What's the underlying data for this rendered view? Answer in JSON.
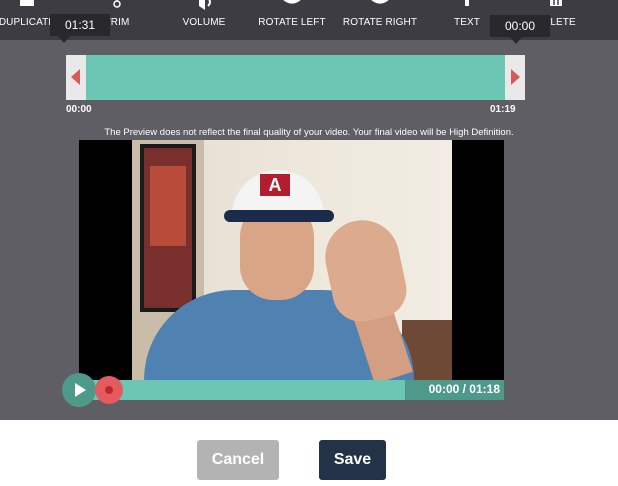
{
  "toolbar": {
    "items": [
      {
        "label": "DUPLICATE",
        "icon": "duplicate-icon"
      },
      {
        "label": "TRIM",
        "icon": "trim-icon"
      },
      {
        "label": "VOLUME",
        "icon": "volume-icon"
      },
      {
        "label": "ROTATE LEFT",
        "icon": "rotate-left-icon"
      },
      {
        "label": "ROTATE RIGHT",
        "icon": "rotate-right-icon"
      },
      {
        "label": "TEXT",
        "icon": "text-icon"
      },
      {
        "label": "DELETE",
        "icon": "delete-icon"
      }
    ]
  },
  "trim": {
    "start_tooltip": "01:31",
    "end_tooltip": "00:00",
    "start_label": "00:00",
    "end_label": "01:19"
  },
  "notice": "The Preview does not reflect the final quality of your video. Your final video will be High Definition.",
  "playback": {
    "timecode": "00:00 / 01:18",
    "progress_fraction": 0.76
  },
  "buttons": {
    "cancel": "Cancel",
    "save": "Save"
  },
  "colors": {
    "accent": "#6cc6b4",
    "save_bg": "#243247",
    "cancel_bg": "#b3b3b3",
    "marker": "#e45a5e"
  }
}
